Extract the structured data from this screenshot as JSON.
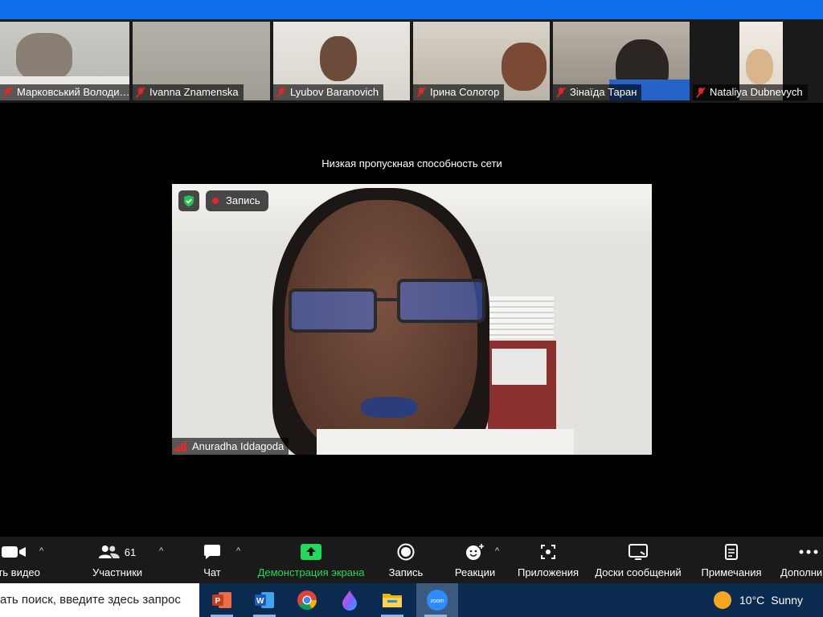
{
  "participants": [
    {
      "name": "Марковський Володи…",
      "muted": true
    },
    {
      "name": "Ivanna Znamenska",
      "muted": true
    },
    {
      "name": "Lyubov Baranovich",
      "muted": true
    },
    {
      "name": "Ірина Сологор",
      "muted": true
    },
    {
      "name": "Зінаїда Таран",
      "muted": true
    },
    {
      "name": "Nataliya Dubnevych",
      "muted": true
    }
  ],
  "main": {
    "notice": "Низкая пропускная способность сети",
    "recording_label": "Запись",
    "speaker_name": "Anuradha Iddagoda"
  },
  "toolbar": {
    "video_label": "ить видео",
    "participants_label": "Участники",
    "participants_count": "61",
    "chat_label": "Чат",
    "share_label": "Демонстрация экрана",
    "record_label": "Запись",
    "reactions_label": "Реакции",
    "apps_label": "Приложения",
    "whiteboards_label": "Доски сообщений",
    "notes_label": "Примечания",
    "more_label": "Дополни"
  },
  "taskbar": {
    "search_placeholder": "ать поиск, введите здесь запрос",
    "apps": [
      "powerpoint-icon",
      "word-icon",
      "chrome-icon",
      "paint-icon",
      "file-explorer-icon",
      "zoom-icon"
    ],
    "weather_temp": "10°C",
    "weather_desc": "Sunny"
  },
  "colors": {
    "accent": "#0e71eb",
    "share_green": "#23d959",
    "record_red": "#e02828"
  }
}
